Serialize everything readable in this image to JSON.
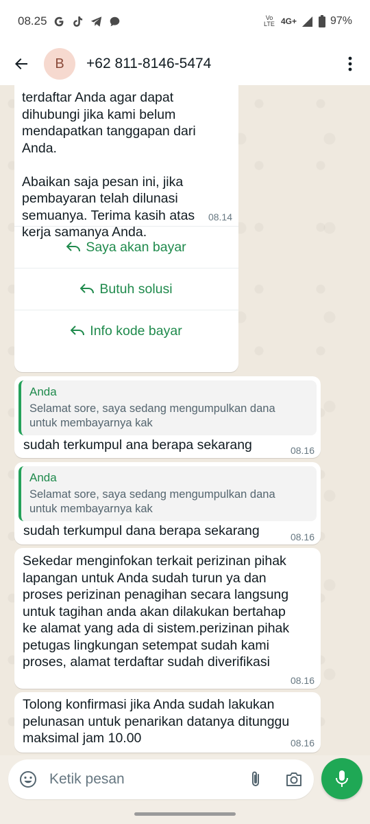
{
  "status_bar": {
    "time": "08.25",
    "network": "4G+",
    "volte": "Vo LTE",
    "battery": "97%"
  },
  "header": {
    "avatar_letter": "B",
    "contact_name": "+62 811-8146-5474"
  },
  "messages": [
    {
      "text": "terdaftar Anda agar dapat\ndihubungi jika kami belum\nmendapatkan tanggapan dari\nAnda.\n\nAbaikan saja pesan ini, jika\npembayaran telah dilunasi\nsemuanya. Terima kasih atas\nkerja samanya Anda.",
      "time": "08.14",
      "buttons": [
        "Saya akan bayar",
        "Butuh solusi",
        "Info kode bayar"
      ]
    },
    {
      "quote_author": "Anda",
      "quote_text": "Selamat sore, saya sedang mengumpulkan dana\nuntuk membayarnya kak",
      "text": "sudah terkumpul ana berapa sekarang",
      "time": "08.16"
    },
    {
      "quote_author": "Anda",
      "quote_text": "Selamat sore, saya sedang mengumpulkan dana\nuntuk membayarnya kak",
      "text": "sudah terkumpul dana berapa sekarang",
      "time": "08.16"
    },
    {
      "text": "Sekedar menginfokan terkait perizinan pihak\nlapangan untuk Anda sudah turun ya dan\nproses perizinan penagihan secara langsung\nuntuk tagihan anda akan dilakukan bertahap\nke alamat yang ada di sistem.perizinan pihak\npetugas lingkungan setempat sudah kami\nproses, alamat terdaftar sudah diverifikasi",
      "time": "08.16"
    },
    {
      "text": "Tolong konfirmasi jika Anda sudah lakukan\npelunasan untuk penarikan datanya ditunggu\nmaksimal jam 10.00",
      "time": "08.16"
    }
  ],
  "input": {
    "placeholder": "Ketik pesan"
  },
  "colors": {
    "accent_green": "#1fa855",
    "button_text_green": "#1f8a4c",
    "chat_background": "#efe9df",
    "bubble": "#ffffff"
  }
}
